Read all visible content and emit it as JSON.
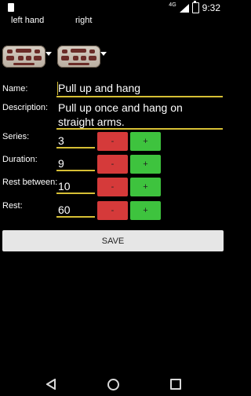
{
  "status_bar": {
    "time": "9:32",
    "network": "4G"
  },
  "hands": {
    "left_label": "left hand",
    "right_label": "right"
  },
  "form": {
    "name_label": "Name:",
    "name_value": "Pull up and hang",
    "description_label": "Description:",
    "description_line1": "Pull up once and hang on",
    "description_line2": "straight arms.",
    "series_label": "Series:",
    "series_value": "3",
    "duration_label": "Duration:",
    "duration_value": "9",
    "rest_between_label": "Rest between:",
    "rest_between_value": "10",
    "rest_label": "Rest:",
    "rest_value": "60",
    "minus_label": "-",
    "plus_label": "+"
  },
  "save_label": "SAVE",
  "colors": {
    "minus": "#d53a3a",
    "plus": "#3ec33e",
    "underline": "#d6bf35"
  }
}
